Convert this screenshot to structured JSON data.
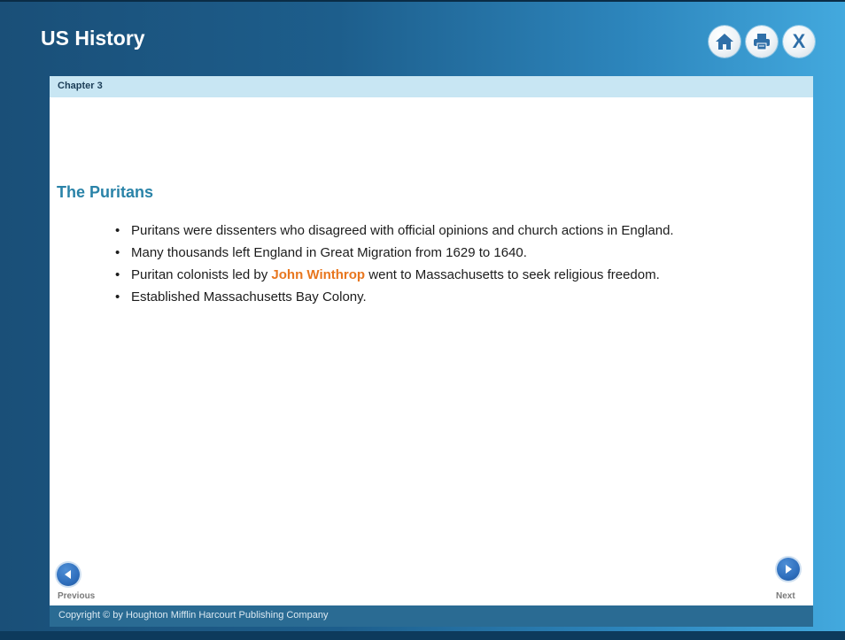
{
  "window": {
    "title": "US History"
  },
  "toolbar": {
    "home_icon": "home-icon",
    "print_icon": "print-icon",
    "close_label": "X"
  },
  "chapter": {
    "label": "Chapter 3"
  },
  "main": {
    "heading": "The Puritans",
    "bullets": [
      {
        "text": "Puritans were dissenters who disagreed with official opinions and church actions in England."
      },
      {
        "text": "Many thousands left England in Great Migration from 1629 to 1640."
      },
      {
        "before": "Puritan colonists led by ",
        "highlight": "John Winthrop",
        "after": " went to Massachusetts to seek religious freedom."
      },
      {
        "text": "Established Massachusetts Bay Colony."
      }
    ]
  },
  "nav": {
    "previous_label": "Previous",
    "next_label": "Next"
  },
  "footer": {
    "copyright": "Copyright © by Houghton Mifflin Harcourt Publishing Company"
  },
  "colors": {
    "accent_heading": "#2a83a8",
    "highlight": "#e8761e",
    "chapter_bar": "#c8e6f3",
    "nav_button": "#2f6fbd"
  }
}
